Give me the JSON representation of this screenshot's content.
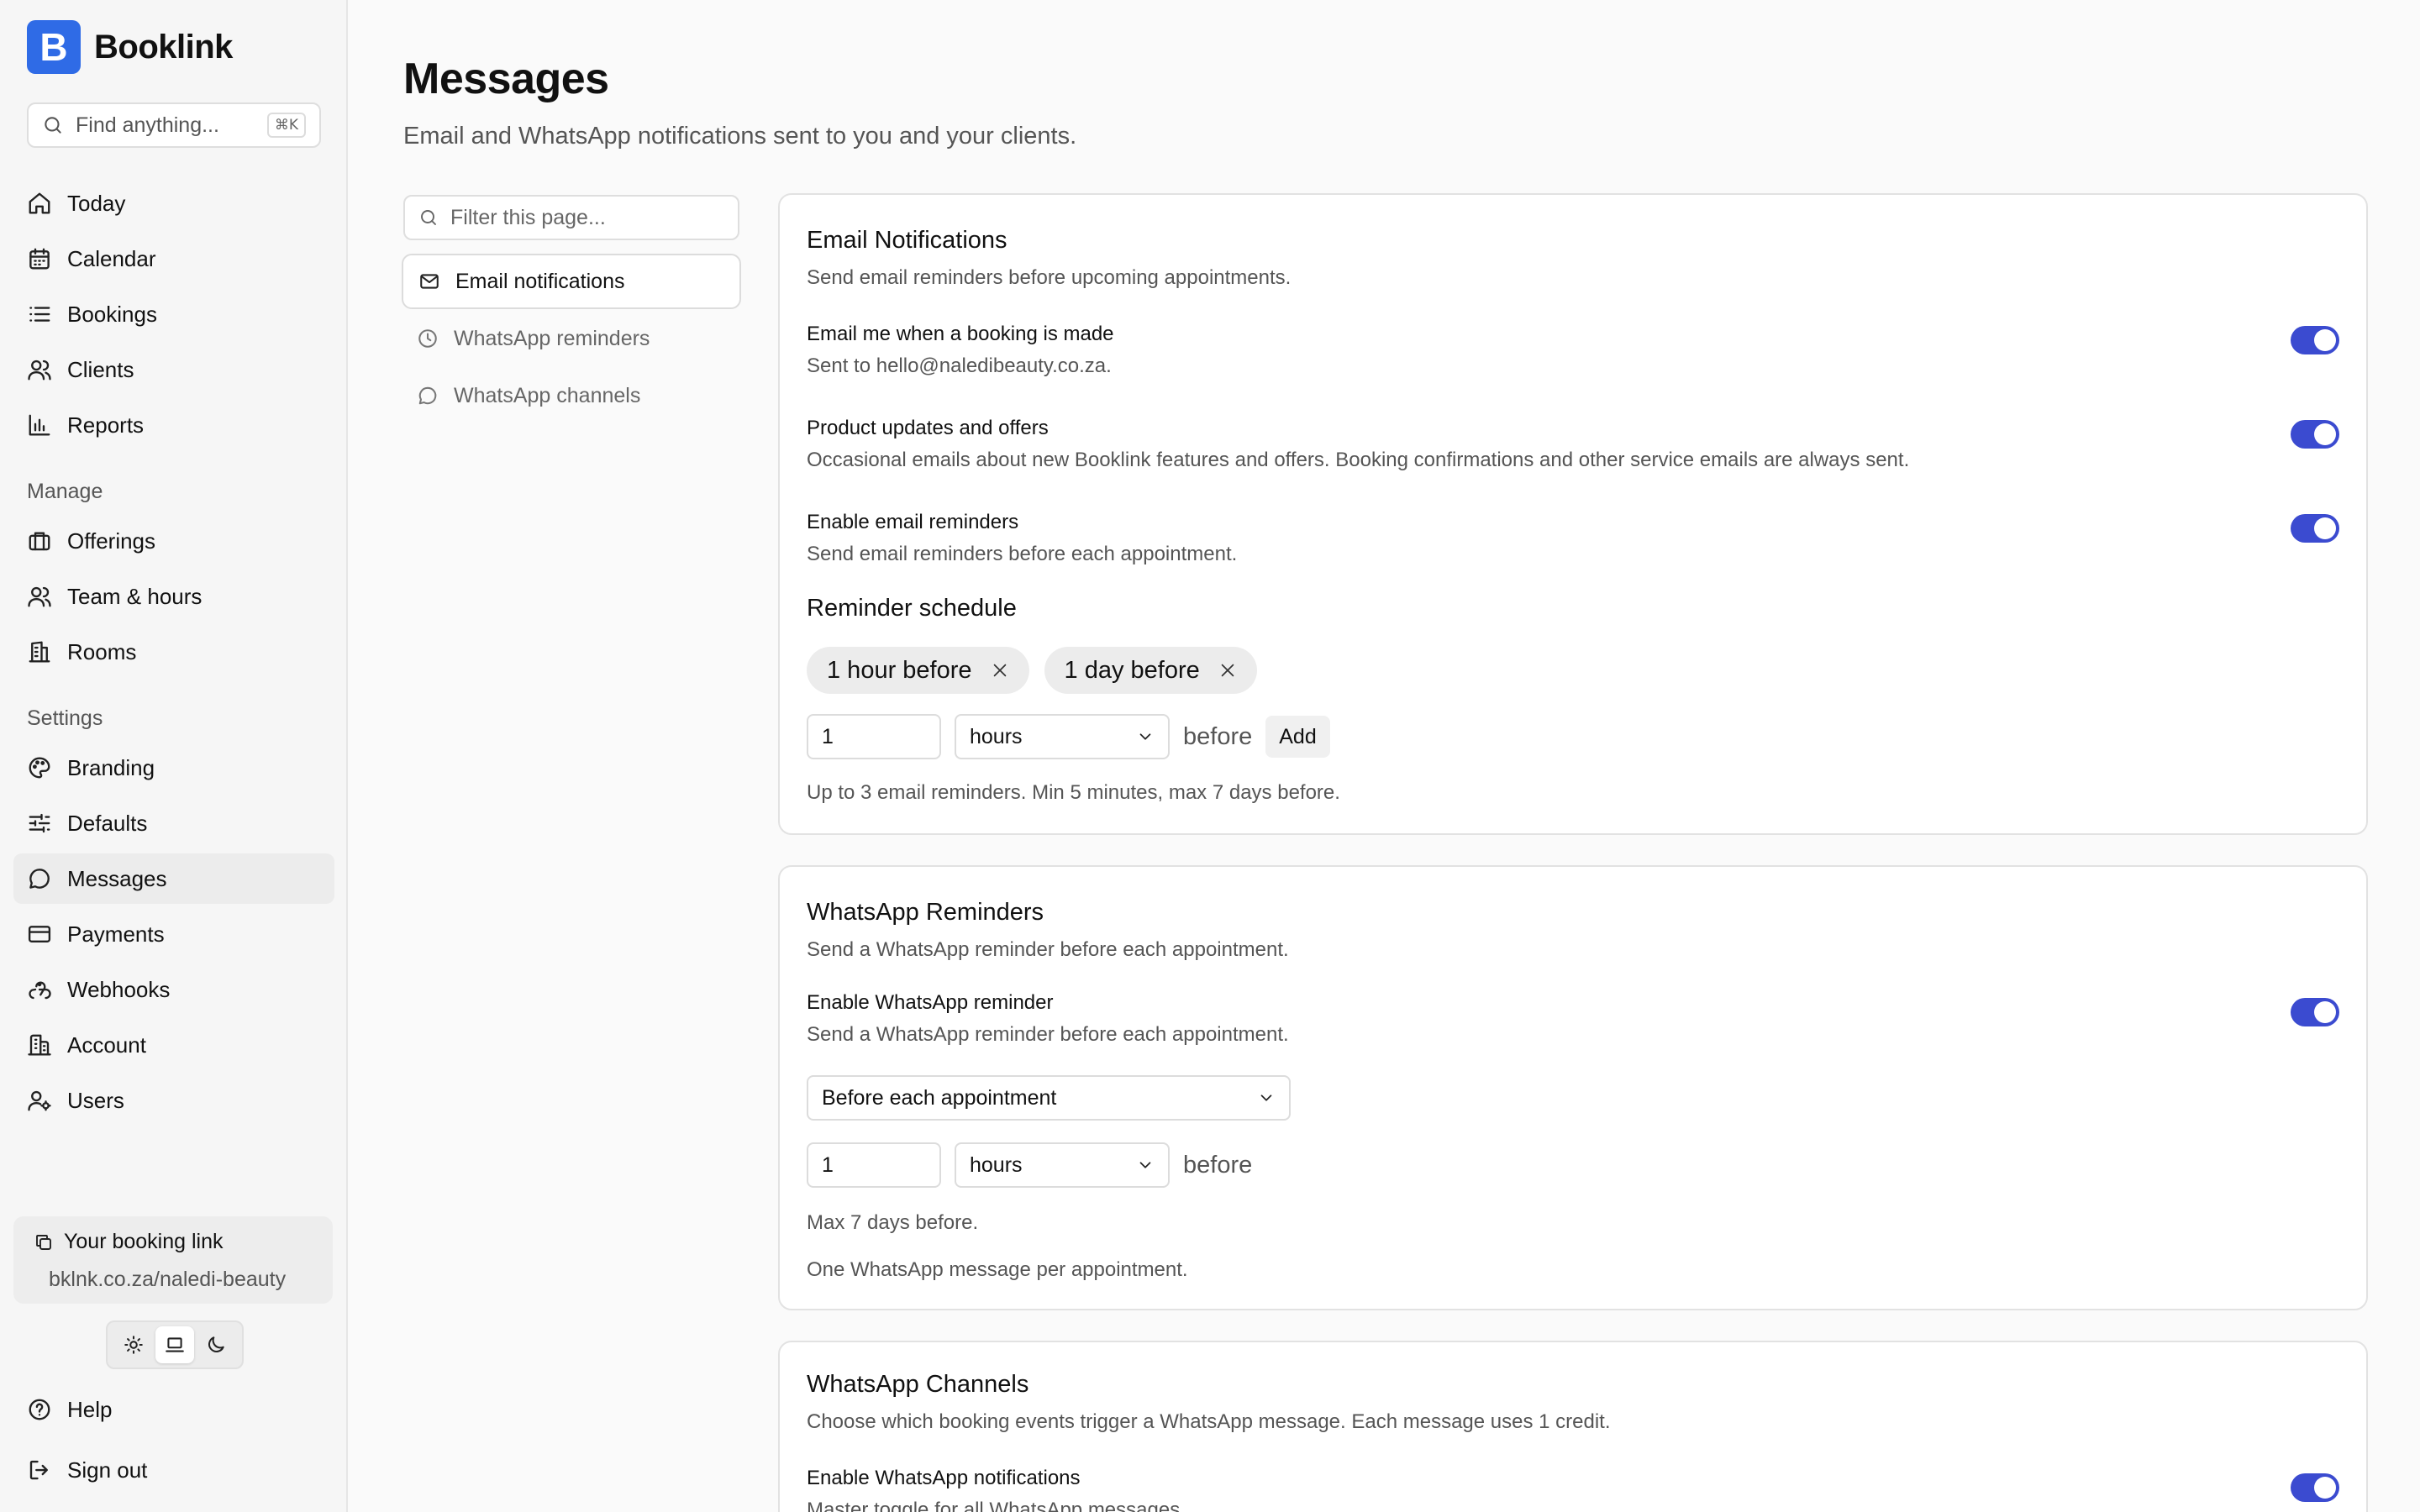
{
  "app": {
    "logo_letter": "B",
    "name": "Booklink"
  },
  "search": {
    "placeholder": "Find anything...",
    "shortcut": "⌘K"
  },
  "nav": {
    "main": [
      {
        "label": "Today",
        "icon": "home-icon"
      },
      {
        "label": "Calendar",
        "icon": "calendar-icon"
      },
      {
        "label": "Bookings",
        "icon": "list-icon"
      },
      {
        "label": "Clients",
        "icon": "users-icon"
      },
      {
        "label": "Reports",
        "icon": "bar-chart-icon"
      }
    ],
    "manage_title": "Manage",
    "manage": [
      {
        "label": "Offerings",
        "icon": "briefcase-icon"
      },
      {
        "label": "Team & hours",
        "icon": "team-icon"
      },
      {
        "label": "Rooms",
        "icon": "building-icon"
      }
    ],
    "settings_title": "Settings",
    "settings": [
      {
        "label": "Branding",
        "icon": "palette-icon"
      },
      {
        "label": "Defaults",
        "icon": "sliders-icon"
      },
      {
        "label": "Messages",
        "icon": "message-icon",
        "active": true
      },
      {
        "label": "Payments",
        "icon": "credit-card-icon"
      },
      {
        "label": "Webhooks",
        "icon": "webhook-icon"
      },
      {
        "label": "Account",
        "icon": "office-icon"
      },
      {
        "label": "Users",
        "icon": "user-cog-icon"
      }
    ]
  },
  "booking_link": {
    "title": "Your booking link",
    "url": "bklnk.co.za/naledi-beauty"
  },
  "theme": {
    "options": [
      "light",
      "system",
      "dark"
    ],
    "selected": "system"
  },
  "footer_nav": {
    "help": "Help",
    "sign_out": "Sign out"
  },
  "page": {
    "title": "Messages",
    "subtitle": "Email and WhatsApp notifications sent to you and your clients.",
    "filter_placeholder": "Filter this page..."
  },
  "subnav": [
    {
      "label": "Email notifications",
      "icon": "mail-icon",
      "active": true
    },
    {
      "label": "WhatsApp reminders",
      "icon": "clock-icon"
    },
    {
      "label": "WhatsApp channels",
      "icon": "chat-bubble-icon"
    }
  ],
  "email_card": {
    "title": "Email Notifications",
    "description": "Send email reminders before upcoming appointments.",
    "settings": [
      {
        "label": "Email me when a booking is made",
        "desc": "Sent to hello@naledibeauty.co.za.",
        "enabled": true
      },
      {
        "label": "Product updates and offers",
        "desc": "Occasional emails about new Booklink features and offers. Booking confirmations and other service emails are always sent.",
        "enabled": true
      },
      {
        "label": "Enable email reminders",
        "desc": "Send email reminders before each appointment.",
        "enabled": true
      }
    ],
    "schedule_title": "Reminder schedule",
    "chips": [
      "1 hour before",
      "1 day before"
    ],
    "amount_value": "1",
    "unit_value": "hours",
    "before_text": "before",
    "add_label": "Add",
    "note": "Up to 3 email reminders. Min 5 minutes, max 7 days before."
  },
  "whatsapp_card": {
    "title": "WhatsApp Reminders",
    "description": "Send a WhatsApp reminder before each appointment.",
    "setting": {
      "label": "Enable WhatsApp reminder",
      "desc": "Send a WhatsApp reminder before each appointment.",
      "enabled": true
    },
    "timing_value": "Before each appointment",
    "amount_value": "1",
    "unit_value": "hours",
    "before_text": "before",
    "note_max": "Max 7 days before.",
    "note_one": "One WhatsApp message per appointment."
  },
  "channels_card": {
    "title": "WhatsApp Channels",
    "description": "Choose which booking events trigger a WhatsApp message. Each message uses 1 credit.",
    "setting": {
      "label": "Enable WhatsApp notifications",
      "desc": "Master toggle for all WhatsApp messages.",
      "enabled": true
    }
  },
  "colors": {
    "accent": "#3b4bd0",
    "brand": "#2f6be6"
  }
}
